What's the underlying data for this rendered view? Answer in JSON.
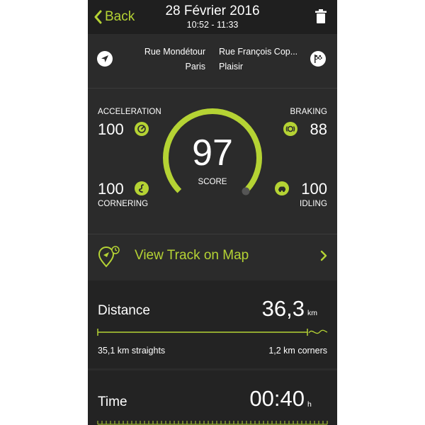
{
  "header": {
    "back_label": "Back",
    "date": "28 Février 2016",
    "time_range": "10:52 - 11:33"
  },
  "route": {
    "start_street": "Rue Mondétour",
    "start_city": "Paris",
    "end_street": "Rue François Cop...",
    "end_city": "Plaisir"
  },
  "score": {
    "value": "97",
    "label": "SCORE",
    "fraction": 0.97
  },
  "metrics": {
    "acceleration": {
      "label": "ACCELERATION",
      "value": "100"
    },
    "braking": {
      "label": "BRAKING",
      "value": "88"
    },
    "cornering": {
      "label": "CORNERING",
      "value": "100"
    },
    "idling": {
      "label": "IDLING",
      "value": "100"
    }
  },
  "map": {
    "label": "View Track on Map"
  },
  "distance": {
    "title": "Distance",
    "value": "36,3",
    "unit": "km",
    "straights": "35,1 km straights",
    "corners": "1,2 km corners"
  },
  "time": {
    "title": "Time",
    "value": "00:40",
    "unit": "h"
  },
  "colors": {
    "accent": "#b5d334",
    "background": "#2b2b2b",
    "header": "#1f1f1f",
    "section": "#232323"
  }
}
